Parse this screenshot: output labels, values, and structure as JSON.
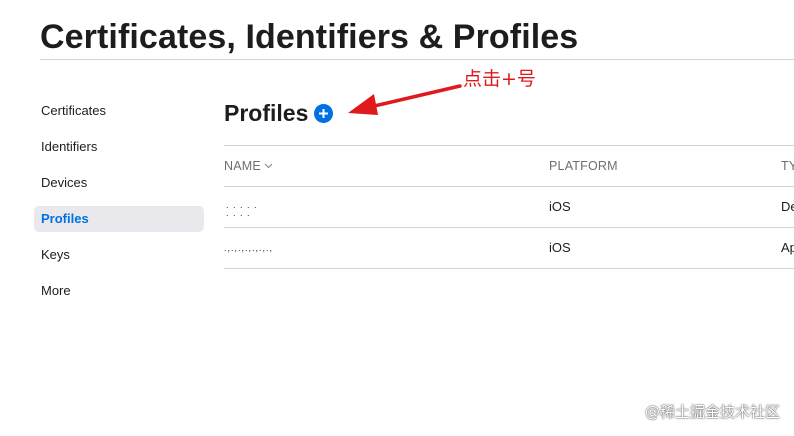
{
  "page": {
    "title": "Certificates, Identifiers & Profiles"
  },
  "sidebar": {
    "items": [
      {
        "label": "Certificates",
        "active": false
      },
      {
        "label": "Identifiers",
        "active": false
      },
      {
        "label": "Devices",
        "active": false
      },
      {
        "label": "Profiles",
        "active": true
      },
      {
        "label": "Keys",
        "active": false
      },
      {
        "label": "More",
        "active": false
      }
    ]
  },
  "main": {
    "section_title": "Profiles",
    "add_button_icon": "plus-circle-icon",
    "table": {
      "columns": [
        "NAME",
        "PLATFORM",
        "TY"
      ],
      "sort_icon": "chevron-down-icon",
      "rows": [
        {
          "name": "",
          "platform": "iOS",
          "type": "De"
        },
        {
          "name": "",
          "platform": "iOS",
          "type": "Ap"
        }
      ]
    }
  },
  "annotation": {
    "text": "点击+号",
    "color": "#e0191c"
  },
  "watermark": {
    "text": "@稀土掘金技术社区"
  },
  "colors": {
    "accent": "#0071e3",
    "active_bg": "#e8e8ed",
    "divider": "#d2d2d7",
    "annotation_red": "#e0191c"
  }
}
